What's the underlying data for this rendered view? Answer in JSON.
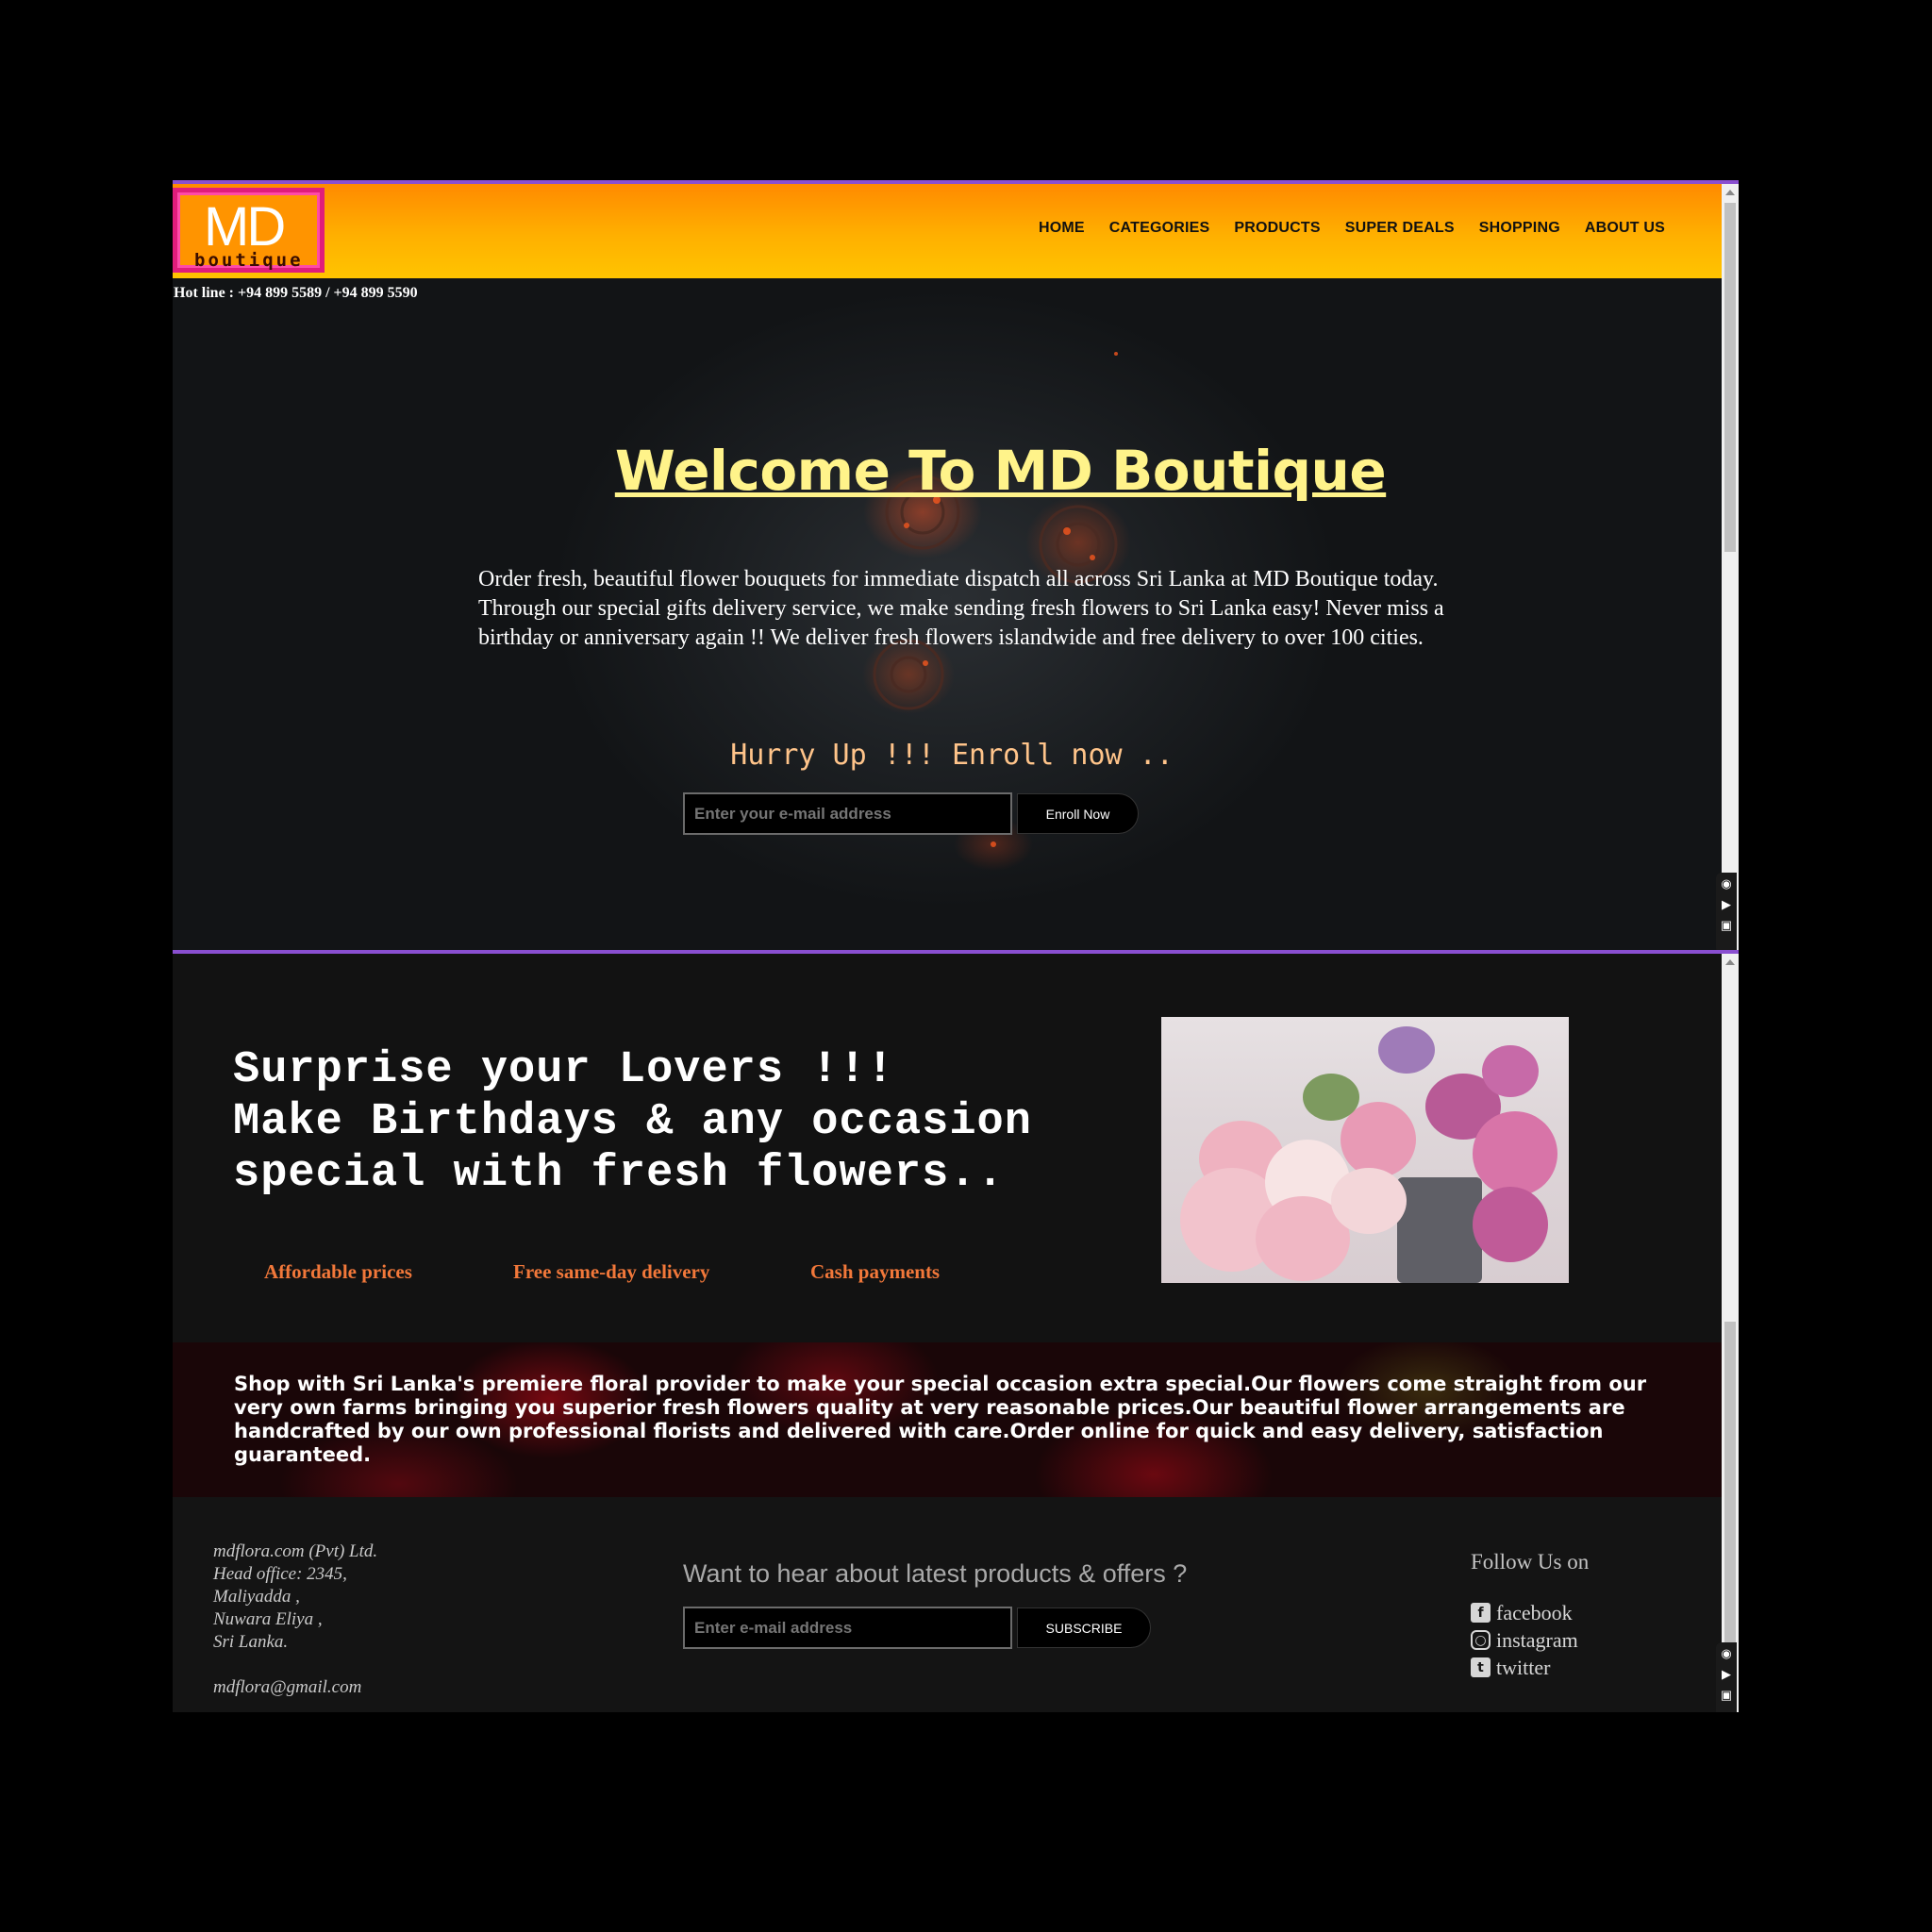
{
  "header": {
    "logo_main": "MD",
    "logo_sub": "boutique",
    "nav": [
      "HOME",
      "CATEGORIES",
      "PRODUCTS",
      "SUPER DEALS",
      "SHOPPING",
      "ABOUT US"
    ],
    "hotline": "Hot line : +94 899 5589 / +94 899 5590"
  },
  "hero": {
    "title": "Welcome To MD Boutique",
    "text": "Order fresh, beautiful flower bouquets for immediate dispatch all across Sri Lanka at MD Boutique today. Through our special gifts delivery service, we make sending fresh flowers to Sri Lanka easy! Never miss a birthday or anniversary again !! We deliver fresh flowers islandwide and free delivery to over 100 cities.",
    "cta_heading": "Hurry Up !!! Enroll now ..",
    "email_placeholder": "Enter your e-mail address",
    "enroll_label": "Enroll Now"
  },
  "promo": {
    "title": "Surprise your Lovers !!!\nMake Birthdays & any occasion\nspecial with fresh flowers..",
    "features": [
      "Affordable prices",
      "Free same-day delivery",
      "Cash payments"
    ],
    "band_text": "Shop with Sri Lanka's premiere floral provider to make your special occasion extra special.Our flowers come straight from our very own farms bringing you superior fresh flowers quality at very reasonable prices.Our beautiful flower arrangements are handcrafted by our own professional florists and delivered with care.Order online for quick and easy delivery, satisfaction guaranteed."
  },
  "footer": {
    "address": [
      "mdflora.com (Pvt) Ltd.",
      "Head office: 2345,",
      "Maliyadda ,",
      "Nuwara Eliya ,",
      "Sri Lanka."
    ],
    "email": "mdflora@gmail.com",
    "newsletter_title": "Want to hear about latest products & offers ?",
    "subscribe_placeholder": "Enter e-mail address",
    "subscribe_label": "SUBSCRIBE",
    "follow_title": "Follow Us on",
    "social": [
      {
        "label": "facebook",
        "icon": "facebook-icon"
      },
      {
        "label": "instagram",
        "icon": "instagram-icon"
      },
      {
        "label": "twitter",
        "icon": "twitter-icon"
      }
    ]
  },
  "colors": {
    "header_gradient_top": "#ff8a00",
    "header_gradient_bottom": "#ffc400",
    "logo_border": "#e01d7b",
    "hero_title": "#fff38a",
    "feature_text": "#f2783a",
    "panel_border": "#8a4fd0"
  }
}
